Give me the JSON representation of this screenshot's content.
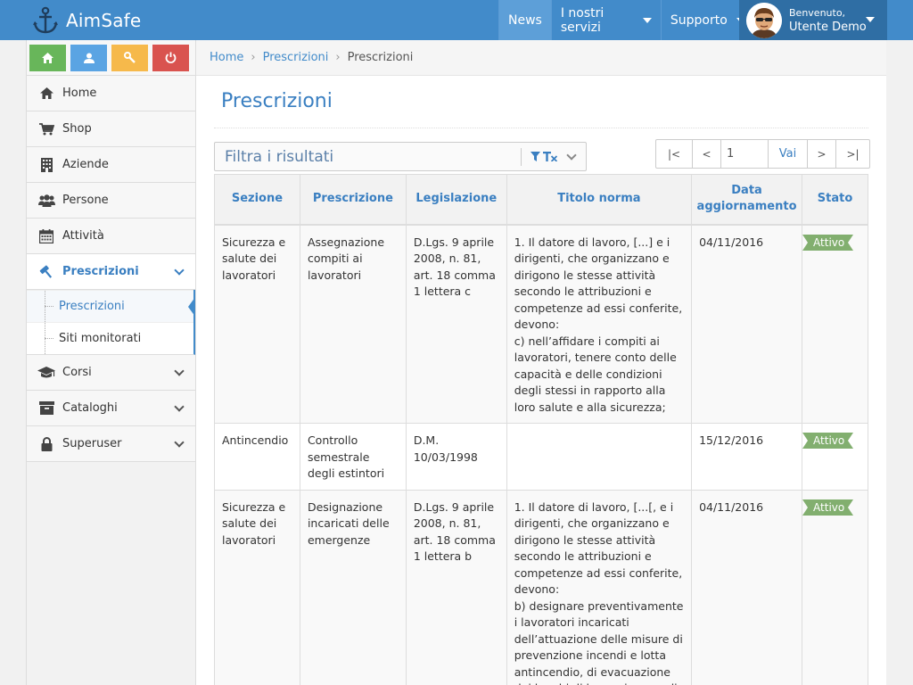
{
  "app": {
    "name": "AimSafe"
  },
  "topnav": {
    "news": "News",
    "servizi": "I nostri servizi",
    "supporto": "Supporto"
  },
  "user": {
    "welcome": "Benvenuto,",
    "name": "Utente Demo"
  },
  "sidebar": {
    "items": [
      {
        "label": "Home"
      },
      {
        "label": "Shop"
      },
      {
        "label": "Aziende"
      },
      {
        "label": "Persone"
      },
      {
        "label": "Attività"
      },
      {
        "label": "Prescrizioni"
      },
      {
        "label": "Corsi"
      },
      {
        "label": "Cataloghi"
      },
      {
        "label": "Superuser"
      }
    ],
    "submenu": [
      {
        "label": "Prescrizioni"
      },
      {
        "label": "Siti monitorati"
      }
    ]
  },
  "breadcrumb": {
    "home": "Home",
    "level1": "Prescrizioni",
    "current": "Prescrizioni"
  },
  "page": {
    "title": "Prescrizioni"
  },
  "filter": {
    "placeholder": "Filtra i risultati"
  },
  "pager": {
    "first": "|<",
    "prev": "<",
    "page": "1",
    "go": "Vai",
    "next": ">",
    "last": ">|"
  },
  "table": {
    "headers": [
      "Sezione",
      "Prescrizione",
      "Legislazione",
      "Titolo norma",
      "Data aggiornamento",
      "Stato"
    ],
    "rows": [
      {
        "sezione": "Sicurezza e salute dei lavoratori",
        "prescrizione": "Assegnazione compiti ai lavoratori",
        "legislazione": "D.Lgs. 9 aprile 2008, n. 81, art. 18 comma 1 lettera c",
        "titolo": "1. Il datore di lavoro, [...] e i dirigenti, che organizzano e dirigono le stesse attività secondo le attribuzioni e competenze ad essi conferite, devono:\nc) nell’affidare i compiti ai lavoratori, tenere conto delle capacità e delle condizioni degli stessi in rapporto alla loro salute e alla sicurezza;",
        "data": "04/11/2016",
        "stato": "Attivo"
      },
      {
        "sezione": "Antincendio",
        "prescrizione": "Controllo semestrale degli estintori",
        "legislazione": "D.M. 10/03/1998",
        "titolo": "",
        "data": "15/12/2016",
        "stato": "Attivo"
      },
      {
        "sezione": "Sicurezza e salute dei lavoratori",
        "prescrizione": "Designazione incaricati delle emergenze",
        "legislazione": "D.Lgs. 9 aprile 2008, n. 81, art. 18 comma 1 lettera b",
        "titolo": "1. Il datore di lavoro, [...[, e i dirigenti, che organizzano e dirigono le stesse attività secondo le attribuzioni e competenze ad essi conferite, devono:\nb) designare preventivamente i lavoratori incaricati dell’attuazione delle misure di prevenzione incendi e lotta antincendio, di evacuazione dei luoghi di lavoro in caso di",
        "data": "04/11/2016",
        "stato": "Attivo"
      }
    ]
  },
  "colors": {
    "primary": "#428bca",
    "accent": "#3a7fc1",
    "badge": "#82af6f"
  }
}
